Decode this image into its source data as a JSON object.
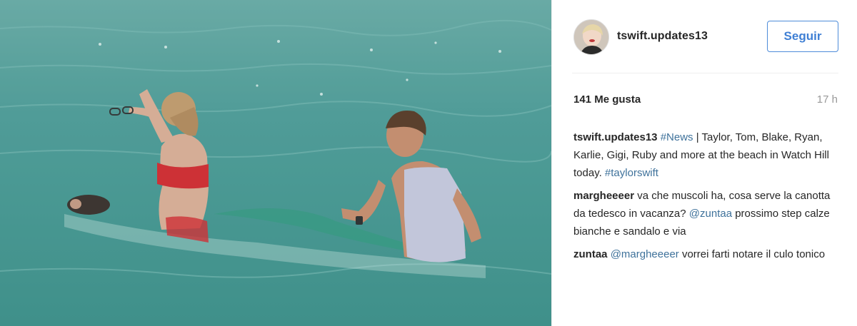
{
  "header": {
    "username": "tswift.updates13",
    "follow_label": "Seguir"
  },
  "stats": {
    "likes": "141 Me gusta",
    "time": "17 h"
  },
  "caption": {
    "user": "tswift.updates13",
    "hashtag": "#News",
    "text": " | Taylor, Tom, Blake, Ryan, Karlie, Gigi, Ruby and more at the beach in Watch Hill today. ",
    "hashtag2": "#taylorswift"
  },
  "comments": [
    {
      "user": "margheeeer",
      "text_before": " va che muscoli ha, cosa serve la canotta da tedesco in vacanza? ",
      "mention": "@zuntaa",
      "text_after": " prossimo step calze bianche e sandalo e via"
    },
    {
      "user": "zuntaa",
      "text_before": " ",
      "mention": "@margheeeer",
      "text_after": " vorrei farti notare il culo tonico"
    }
  ],
  "colors": {
    "sea": "#4a9c98",
    "link": "#3f729b",
    "follow": "#3f7fd4"
  }
}
